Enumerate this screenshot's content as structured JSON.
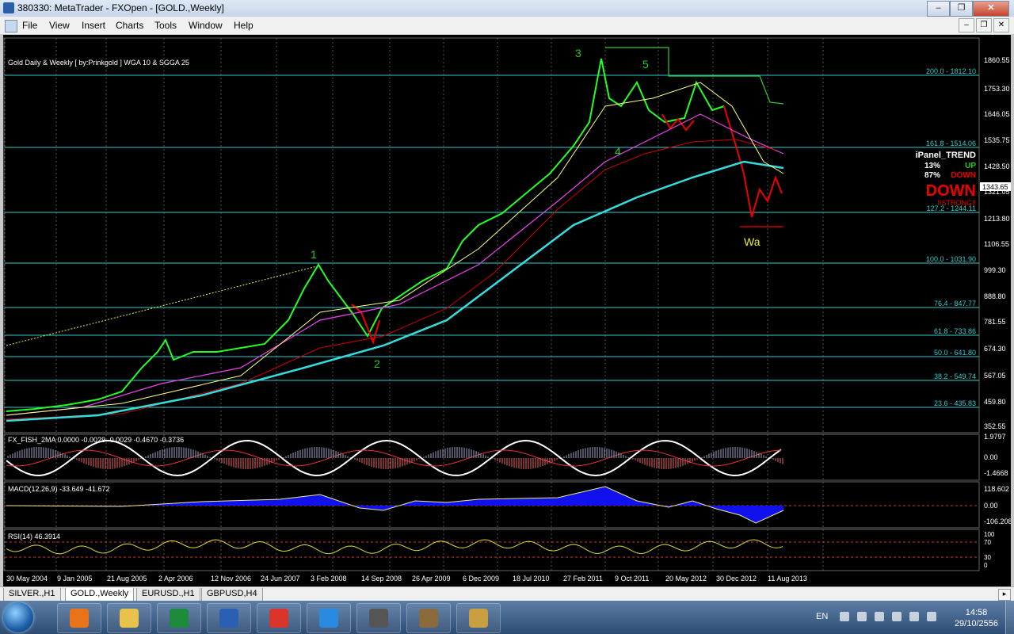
{
  "window": {
    "title": "380330: MetaTrader - FXOpen - [GOLD.,Weekly]",
    "controls": [
      "–",
      "❐",
      "✕"
    ]
  },
  "menu": {
    "items": [
      "File",
      "View",
      "Insert",
      "Charts",
      "Tools",
      "Window",
      "Help"
    ],
    "mdi_controls": [
      "–",
      "❐",
      "✕"
    ]
  },
  "chart": {
    "indicator_title": "Gold Daily & Weekly [ by:Prinkgold ]  WGA 10  &  SGGA 25",
    "price_axis": [
      "1860.55",
      "1753.30",
      "1646.05",
      "1535.75",
      "1428.50",
      "1321.05",
      "1213.80",
      "1106.55",
      "999.30",
      "888.80",
      "781.55",
      "674.30",
      "567.05",
      "459.80",
      "352.55"
    ],
    "current_price": "1343.65",
    "fib_levels": [
      {
        "label": "200.0 - 1812.10",
        "color": "#3cc"
      },
      {
        "label": "161.8 - 1514.06",
        "color": "#3cc"
      },
      {
        "label": "127.2 - 1244.11",
        "color": "#3cc"
      },
      {
        "label": "100.0 - 1031.90",
        "color": "#3cc"
      },
      {
        "label": "76.4 - 847.77",
        "color": "#3cc"
      },
      {
        "label": "61.8 - 733.86",
        "color": "#3cc"
      },
      {
        "label": "50.0 - 641.80",
        "color": "#3cc"
      },
      {
        "label": "38.2 - 549.74",
        "color": "#3cc"
      },
      {
        "label": "23.6 - 435.83",
        "color": "#3cc"
      }
    ],
    "wave_labels": [
      "1",
      "2",
      "3",
      "4",
      "5",
      "Wa"
    ],
    "ipanel": {
      "title": "iPanel_TREND",
      "up_pct": "13%",
      "up_label": "UP",
      "down_pct": "87%",
      "down_label": "DOWN",
      "big_label": "DOWN",
      "strength": "!!STRONG!!"
    },
    "fisher": {
      "label": "FX_FISH_2MA 0.0000 -0.0029 -0.0029 -0.4670 -0.3736",
      "axis": [
        "1.9797",
        "0.00",
        "-1.4668"
      ]
    },
    "macd": {
      "label": "MACD(12,26,9) -33.649 -41.672",
      "axis": [
        "118.602",
        "0.00",
        "-106.208"
      ]
    },
    "rsi": {
      "label": "RSI(14) 46.3914",
      "axis": [
        "100",
        "70",
        "30",
        "0"
      ]
    },
    "dates": [
      "30 May 2004",
      "9 Jan 2005",
      "21 Aug 2005",
      "2 Apr 2006",
      "12 Nov 2006",
      "24 Jun 2007",
      "3 Feb 2008",
      "14 Sep 2008",
      "26 Apr 2009",
      "6 Dec 2009",
      "18 Jul 2010",
      "27 Feb 2011",
      "9 Oct 2011",
      "20 May 2012",
      "30 Dec 2012",
      "11 Aug 2013"
    ]
  },
  "tabs": {
    "items": [
      "SILVER.,H1",
      "GOLD.,Weekly",
      "EURUSD.,H1",
      "GBPUSD,H4"
    ],
    "active": "GOLD.,Weekly",
    "nav": "▸"
  },
  "taskbar": {
    "apps": [
      {
        "name": "media-player",
        "color": "#e8731a"
      },
      {
        "name": "file-explorer",
        "color": "#e8c24a"
      },
      {
        "name": "excel",
        "color": "#1e8a3c"
      },
      {
        "name": "word",
        "color": "#2b5fb4"
      },
      {
        "name": "chrome",
        "color": "#d9352a"
      },
      {
        "name": "internet-explorer",
        "color": "#2a8ae0"
      },
      {
        "name": "metatrader",
        "color": "#555"
      },
      {
        "name": "gimp",
        "color": "#8a6a3a"
      },
      {
        "name": "paint",
        "color": "#c8a040"
      }
    ],
    "language": "EN",
    "time": "14:58",
    "date": "29/10/2556"
  }
}
